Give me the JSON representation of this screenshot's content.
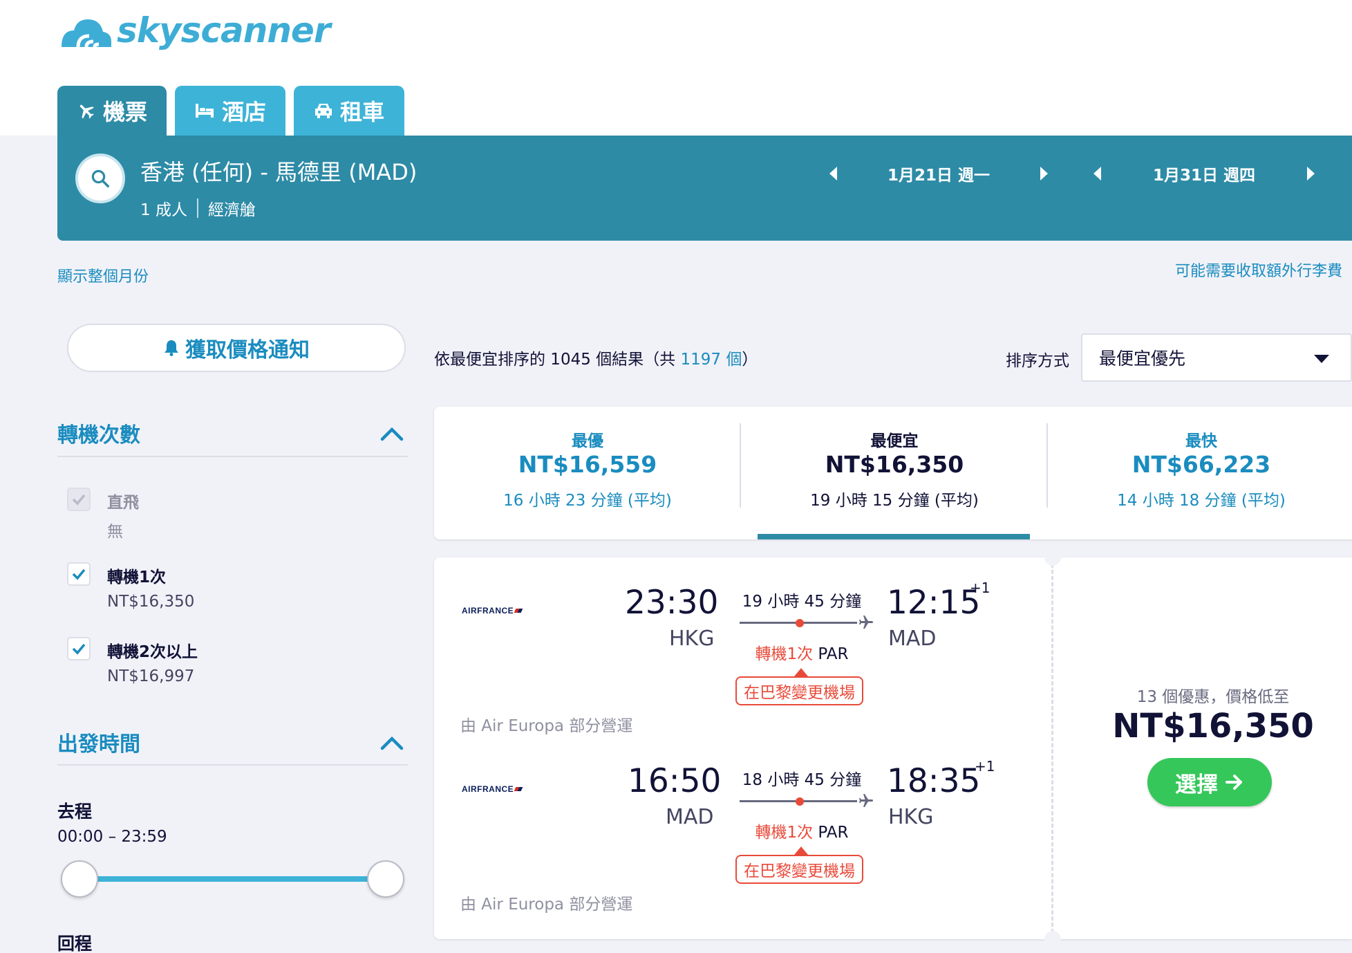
{
  "brand": {
    "name": "skyscanner",
    "color": "#3dadd6"
  },
  "tabs": [
    {
      "label": "機票",
      "icon": "plane-icon"
    },
    {
      "label": "酒店",
      "icon": "bed-icon"
    },
    {
      "label": "租車",
      "icon": "car-icon"
    }
  ],
  "search": {
    "route": "香港 (任何) - 馬德里 (MAD)",
    "passengers": "1 成人",
    "cabin": "經濟艙",
    "depart_date": "1月21日 週一",
    "return_date": "1月31日 週四"
  },
  "links": {
    "show_month": "顯示整個月份",
    "baggage": "可能需要收取額外行李費"
  },
  "price_alert": {
    "label": "獲取價格通知"
  },
  "filters": {
    "stops": {
      "title": "轉機次數",
      "options": [
        {
          "label": "直飛",
          "sub": "無",
          "checked": true,
          "disabled": true
        },
        {
          "label": "轉機1次",
          "sub": "NT$16,350",
          "checked": true,
          "disabled": false
        },
        {
          "label": "轉機2次以上",
          "sub": "NT$16,997",
          "checked": true,
          "disabled": false
        }
      ]
    },
    "times": {
      "title": "出發時間",
      "outbound_label": "去程",
      "outbound_range": "00:00 – 23:59",
      "return_label": "回程"
    }
  },
  "results": {
    "count_prefix": "依最便宜排序的 1045 個結果（共 ",
    "total": "1197 個",
    "count_suffix": "）"
  },
  "sort": {
    "label": "排序方式",
    "selected": "最便宜優先"
  },
  "summary": [
    {
      "title": "最優",
      "price": "NT$16,559",
      "duration": "16 小時 23 分鐘 (平均)"
    },
    {
      "title": "最便宜",
      "price": "NT$16,350",
      "duration": "19 小時 15 分鐘 (平均)"
    },
    {
      "title": "最快",
      "price": "NT$66,223",
      "duration": "14 小時 18 分鐘 (平均)"
    }
  ],
  "result_card": {
    "legs": [
      {
        "airline": "AIRFRANCE",
        "depart_time": "23:30",
        "depart_airport": "HKG",
        "arrive_time": "12:15",
        "arrive_airport": "MAD",
        "day_offset": "+1",
        "duration": "19 小時 45 分鐘",
        "stops_red": "轉機1次",
        "stops_via": " PAR",
        "warning": "在巴黎變更機場",
        "operated_by": "由 Air Europa 部分營運"
      },
      {
        "airline": "AIRFRANCE",
        "depart_time": "16:50",
        "depart_airport": "MAD",
        "arrive_time": "18:35",
        "arrive_airport": "HKG",
        "day_offset": "+1",
        "duration": "18 小時 45 分鐘",
        "stops_red": "轉機1次",
        "stops_via": " PAR",
        "warning": "在巴黎變更機場",
        "operated_by": "由 Air Europa 部分營運"
      }
    ],
    "deals": "13 個優惠，價格低至",
    "price": "NT$16,350",
    "select_label": "選擇"
  },
  "colors": {
    "accent": "#2d8ba6",
    "tab_inactive": "#3eb3d8",
    "link": "#1a8cbf",
    "warning": "#e84a3a",
    "cta": "#35c75a"
  }
}
